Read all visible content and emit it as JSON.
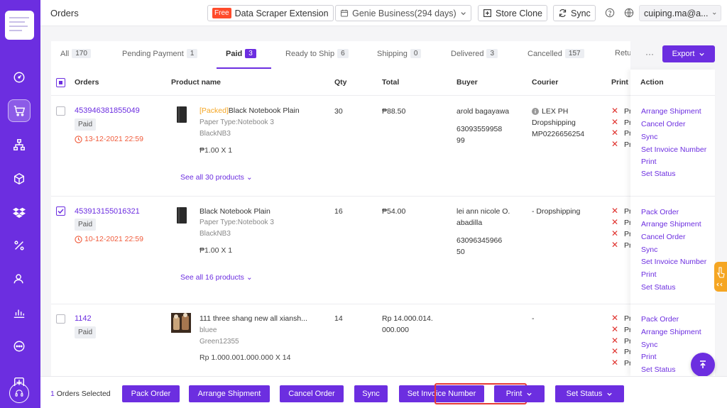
{
  "topbar": {
    "title": "Orders",
    "free_badge": "Free",
    "scraper": "Data Scraper Extension",
    "business": "Genie Business(294 days)",
    "store_clone": "Store Clone",
    "sync": "Sync",
    "user": "cuiping.ma@a..."
  },
  "tabs": [
    {
      "label": "All",
      "count": "170"
    },
    {
      "label": "Pending Payment",
      "count": "1"
    },
    {
      "label": "Paid",
      "count": "3"
    },
    {
      "label": "Ready to Ship",
      "count": "6"
    },
    {
      "label": "Shipping",
      "count": "0"
    },
    {
      "label": "Delivered",
      "count": "3"
    },
    {
      "label": "Cancelled",
      "count": "157"
    },
    {
      "label": "Return"
    }
  ],
  "export_label": "Export",
  "more_label": "···",
  "headers": {
    "orders": "Orders",
    "product": "Product name",
    "qty": "Qty",
    "total": "Total",
    "buyer": "Buyer",
    "courier": "Courier",
    "print": "Print s",
    "action": "Action"
  },
  "rows": [
    {
      "order_no": "453946381855049",
      "status": "Paid",
      "time": "13-12-2021 22:59",
      "packed_tag": "[Packed]",
      "product": "Black Notebook Plain",
      "variant": "Paper Type:Notebook 3",
      "sku": "BlackNB3",
      "price": "₱1.00 X 1",
      "see_all": "See all 30 products",
      "qty": "30",
      "total": "₱88.50",
      "buyer_name": "arold bagayawa",
      "buyer_phone_1": "63093559958",
      "buyer_phone_2": "99",
      "courier_1": "LEX PH",
      "courier_2": "Dropshipping",
      "courier_3": "MP0226656254",
      "print_label": "Pr",
      "actions": [
        "Arrange Shipment",
        "Cancel Order",
        "Sync",
        "Set Invoice Number",
        "Print",
        "Set Status"
      ]
    },
    {
      "order_no": "453913155016321",
      "status": "Paid",
      "time": "10-12-2021 22:59",
      "product": "Black Notebook Plain",
      "variant": "Paper Type:Notebook 3",
      "sku": "BlackNB3",
      "price": "₱1.00 X 1",
      "see_all": "See all 16 products",
      "qty": "16",
      "total": "₱54.00",
      "buyer_name_1": "lei ann nicole O.",
      "buyer_name_2": "abadilla",
      "buyer_phone_1": "63096345966",
      "buyer_phone_2": "50",
      "courier_1": "- Dropshipping",
      "print_label": "Pr",
      "actions": [
        "Pack Order",
        "Arrange Shipment",
        "Cancel Order",
        "Sync",
        "Set Invoice Number",
        "Print",
        "Set Status"
      ]
    },
    {
      "order_no": "1142",
      "status": "Paid",
      "product": "111 three shang new all xiansh...",
      "variant": "bluee",
      "sku": "Green12355",
      "price": "Rp 1.000.001.000.000 X 14",
      "qty": "14",
      "total_1": "Rp 14.000.014.",
      "total_2": "000.000",
      "courier_1": "-",
      "print_label": "Pr",
      "actions": [
        "Pack Order",
        "Arrange Shipment",
        "Sync",
        "Print",
        "Set Status"
      ]
    }
  ],
  "bottom": {
    "selected_count": "1",
    "selected_text": " Orders Selected",
    "pack_order": "Pack Order",
    "arrange_shipment": "Arrange Shipment",
    "cancel_order": "Cancel Order",
    "sync": "Sync",
    "set_invoice": "Set Invoice Number",
    "print": "Print",
    "set_status": "Set Status"
  },
  "colors": {
    "accent": "#6c2ee0",
    "danger": "#e0332f",
    "time": "#f05a3a",
    "packed": "#f5a623"
  }
}
